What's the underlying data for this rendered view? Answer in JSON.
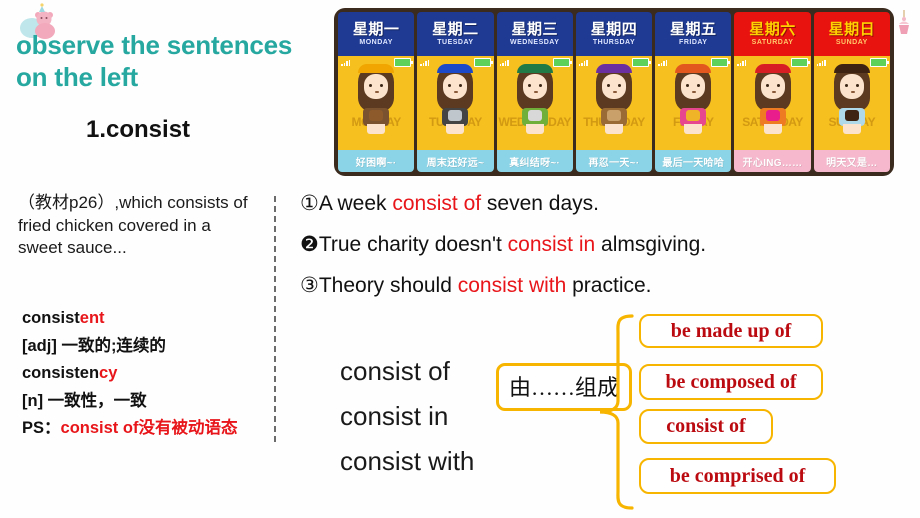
{
  "slide": {
    "heading": "observe the sentences on the left",
    "heading_color": "#26A8A0",
    "subheading": "1.consist",
    "decorations": {
      "top_left": "teddy-bear-sticker",
      "top_right": "cupcake-sticker"
    }
  },
  "sidebar": {
    "note": "（教材p26）,which consists of fried chicken covered in a sweet sauce...",
    "vocab": [
      {
        "word_black": "consist",
        "word_red": "ent"
      },
      {
        "pos": "[adj]",
        "meaning": "一致的;连续的"
      },
      {
        "word_black": "consisten",
        "word_red": "cy"
      },
      {
        "pos": "[n]",
        "meaning": "一致性，一致"
      }
    ],
    "ps_label": "PS：",
    "ps_text": "consist of没有被动语态"
  },
  "sentences": [
    {
      "marker": "①",
      "pre": "A week ",
      "highlight": "consist of",
      "post": " seven days."
    },
    {
      "marker": "❷",
      "pre": "True charity doesn't ",
      "highlight": "consist in",
      "post": " almsgiving."
    },
    {
      "marker": "③",
      "pre": "Theory should ",
      "highlight": "consist with",
      "post": " practice."
    }
  ],
  "diagram": {
    "verbs": [
      "consist of",
      "consist in",
      "consist with"
    ],
    "chinese_gloss": "由……组成",
    "equivalents": [
      "be made up of",
      "be composed of",
      "consist of",
      "be comprised of"
    ],
    "box_border_color": "#F7B500",
    "equivalent_text_color": "#BB0A10"
  },
  "calendar": {
    "days": [
      {
        "cn": "星期一",
        "en": "MONDAY",
        "ghost": "MONDAY",
        "caption": "好困啊~·",
        "weekend": false,
        "band": "#F0A500",
        "outfit": "#7A5230",
        "object": "#8C5A2B"
      },
      {
        "cn": "星期二",
        "en": "TUESDAY",
        "ghost": "TUESDAY",
        "caption": "周末还好远~",
        "weekend": false,
        "band": "#1C49C7",
        "outfit": "#444444",
        "object": "#BFC6CC"
      },
      {
        "cn": "星期三",
        "en": "WEDNESDAY",
        "ghost": "WEDNESDAY",
        "caption": "真纠结呀~·",
        "weekend": false,
        "band": "#1F7A45",
        "outfit": "#6FAF3A",
        "object": "#D8D8D8"
      },
      {
        "cn": "星期四",
        "en": "THURSDAY",
        "ghost": "THURSDAY",
        "caption": "再忍一天~·",
        "weekend": false,
        "band": "#6B2FA0",
        "outfit": "#9A6B35",
        "object": "#C9A06A"
      },
      {
        "cn": "星期五",
        "en": "FRIDAY",
        "ghost": "FRIDAY",
        "caption": "最后一天哈哈",
        "weekend": false,
        "band": "#E2571E",
        "outfit": "#E7478E",
        "object": "#F0B429"
      },
      {
        "cn": "星期六",
        "en": "SATURDAY",
        "ghost": "SATURDAY",
        "caption": "开心ING……",
        "weekend": true,
        "band": "#D81E25",
        "outfit": "#EE7B22",
        "object": "#E91E8C"
      },
      {
        "cn": "星期日",
        "en": "SUNDAY",
        "ghost": "SUNDAY",
        "caption": "明天又是…",
        "weekend": true,
        "band": "#3E2212",
        "outfit": "#AFD8E8",
        "object": "#3E2212"
      }
    ]
  }
}
